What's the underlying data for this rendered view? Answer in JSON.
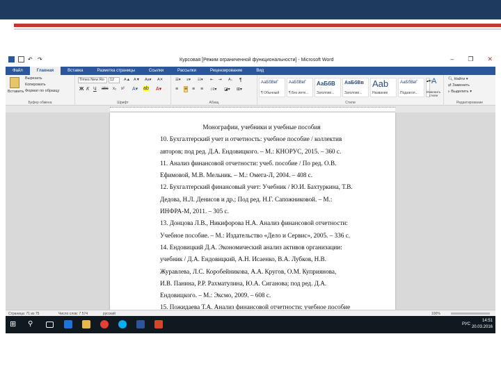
{
  "window": {
    "title": "Курсовая [Режим ограниченной функциональности] - Microsoft Word"
  },
  "tabs": [
    "Файл",
    "Главная",
    "Вставка",
    "Разметка страницы",
    "Ссылки",
    "Рассылки",
    "Рецензирование",
    "Вид"
  ],
  "ribbon": {
    "clipboard": {
      "paste": "Вставить",
      "cut": "Вырезать",
      "copy": "Копировать",
      "format_painter": "Формат по образцу",
      "label": "Буфер обмена"
    },
    "font": {
      "name": "Times New Ro",
      "size": "12",
      "label": "Шрифт"
    },
    "paragraph": {
      "label": "Абзац"
    },
    "styles": {
      "items": [
        {
          "sample": "АаБбВвГ",
          "name": "¶ Обычный"
        },
        {
          "sample": "АаБбВвГ",
          "name": "¶ Без инте..."
        },
        {
          "sample": "АаБбВ",
          "name": "Заголово..."
        },
        {
          "sample": "АаБбВв",
          "name": "Заголово..."
        },
        {
          "sample": "Aab",
          "name": "Название"
        },
        {
          "sample": "АаБбВвГ",
          "name": "Подзагол..."
        }
      ],
      "change": "Изменить стили",
      "label": "Стили"
    },
    "editing": {
      "find": "Найти",
      "replace": "Заменить",
      "select": "Выделить",
      "label": "Редактирование"
    }
  },
  "document": {
    "heading": "Монографии, учебники и учебные пособия",
    "lines": [
      "10. Бухгалтерский учет и отчетность: учебное пособие / коллектив",
      "авторов; под ред. Д.А. Ендовицкого. – М.: КНОРУС, 2015. – 360 с.",
      "11. Анализ финансовой отчетности: учеб. пособие / По ред. О.В.",
      "Ефимовой, М.В. Мельник. – М.: Омега-Л, 2004. – 408 с.",
      "12. Бухгалтерский финансовый учет: Учебник / Ю.И. Бахтуркина, Т.В.",
      "Дедова, Н.Л. Денисов и др.; Под ред. Н.Г. Сапожниковой. – М.:",
      "ИНФРА-М, 2011. – 305 с.",
      "13. Донцова Л.В., Никифорова Н.А. Анализ финансовой отчетности:",
      "Учебное пособие. – М.: Издательство «Дело и Сервис», 2005. – 336 с.",
      "14. Ендовицкий Д.А. Экономический анализ активов организации:",
      "учебник / Д.А. Ендовицкий, А.Н. Исаенко, В.А. Лубков, Н.В.",
      "Журавлева, Л.С. Коробейникова, А.А. Кругов, О.М. Куприянова,",
      "И.В. Панина, Р.Р. Рахматулина, Ю.А. Сиганова; под ред. Д.А.",
      "Ендовицкого. – М.: Эксмо, 2009. – 608 с.",
      "15. Пожидаева Т.А. Анализ финансовой отчетности: учебное пособие"
    ]
  },
  "status": {
    "page": "Страница: 71 из 75",
    "words": "Число слов: 7 574",
    "language": "русский",
    "zoom": "100%"
  },
  "taskbar": {
    "language": "РУС",
    "time": "14:51",
    "date": "20.03.2016"
  },
  "colors": {
    "ribbon_tab": "#2b579a",
    "taskbar": "#101820",
    "deco_bar": "#1f3a5f",
    "deco_stripe": "#c0392b"
  }
}
